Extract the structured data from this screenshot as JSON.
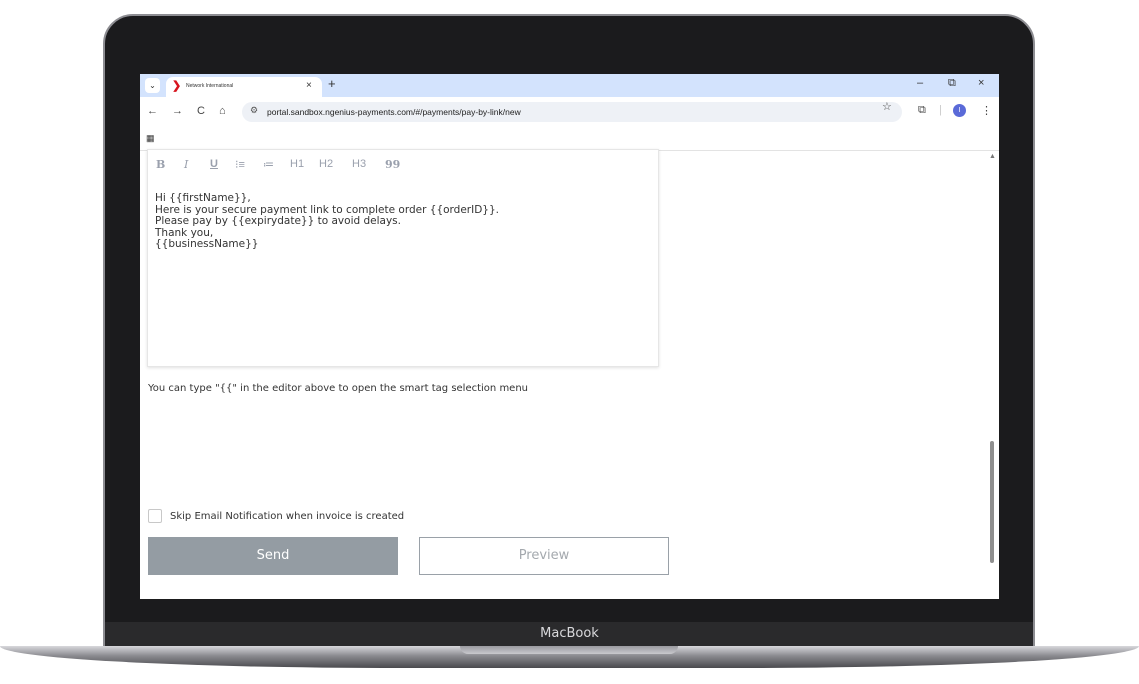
{
  "device": {
    "brand": "MacBook"
  },
  "browser": {
    "tab": {
      "title": "Network International",
      "favicon": "chevron-right-red-icon",
      "close": "×"
    },
    "new_tab": "+",
    "window_controls": {
      "minimize": "–",
      "restore": "⧉",
      "close": "×"
    },
    "nav": {
      "back": "←",
      "forward": "→",
      "reload": "C",
      "home": "⌂"
    },
    "url": "portal.sandbox.ngenius-payments.com/#/payments/pay-by-link/new",
    "profile_initial": "I"
  },
  "editor": {
    "toolbar": [
      "B",
      "I",
      "U",
      "⁝≡",
      "≔",
      "H1",
      "H2",
      "H3",
      "99"
    ],
    "lines": [
      "Hi {{firstName}},",
      "Here is your secure payment link to complete order {{orderID}}.",
      "Please pay by {{expirydate}} to avoid delays.",
      "Thank you,",
      "{{businessName}}"
    ]
  },
  "hint": "You can type \"{{\" in the editor above to open the smart tag selection menu",
  "skip_email": {
    "label": "Skip Email Notification when invoice is created",
    "checked": false
  },
  "buttons": {
    "send": "Send",
    "preview": "Preview"
  }
}
